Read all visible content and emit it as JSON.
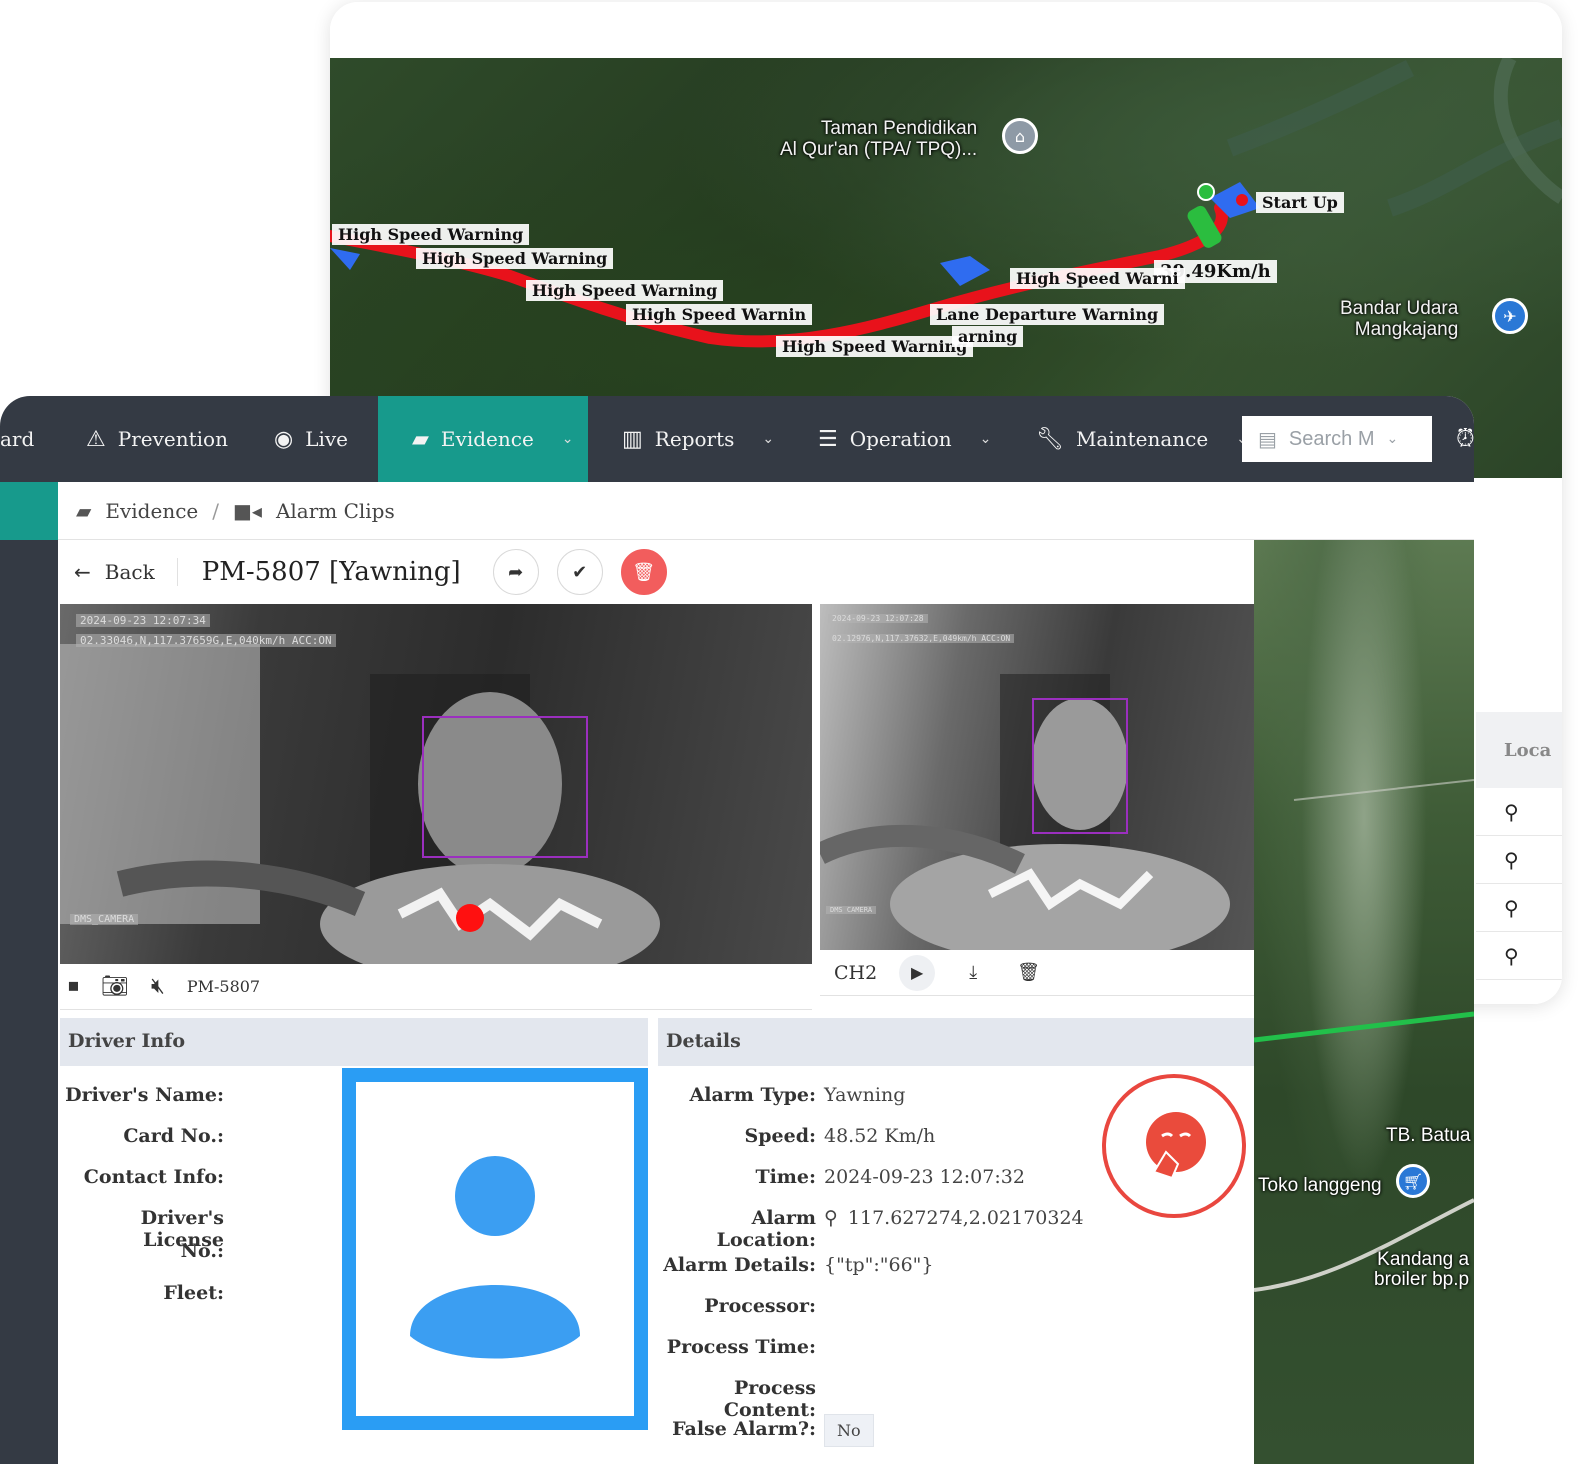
{
  "map": {
    "poi_1": "Taman Pendidikan\nAl Qur'an (TPA/ TPQ)...",
    "airport": "Bandar Udara\nMangkajang",
    "start_label": "Start Up",
    "speed_label": "39.49Km/h",
    "warnings": [
      "High Speed Warning",
      "High Speed Warning",
      "High Speed Warning",
      "High Speed Warnin",
      "High Speed Warning",
      "Lane Departure Warning",
      "High Speed Warni",
      "arning"
    ],
    "side_panel_header": "Loca"
  },
  "nav": {
    "items": [
      {
        "label": "ard"
      },
      {
        "label": "Prevention",
        "icon": "warning-icon"
      },
      {
        "label": "Live",
        "icon": "live-icon"
      },
      {
        "label": "Evidence",
        "icon": "folder-icon"
      },
      {
        "label": "Reports",
        "icon": "bar-chart-icon"
      },
      {
        "label": "Operation",
        "icon": "sliders-icon"
      },
      {
        "label": "Maintenance",
        "icon": "wrench-icon"
      }
    ],
    "search_placeholder": "Search M"
  },
  "breadcrumb": {
    "evidence": "Evidence",
    "separator": "/",
    "alarm_clips": "Alarm Clips"
  },
  "titlebar": {
    "back": "Back",
    "title": "PM-5807 [Yawning]"
  },
  "video_main": {
    "timestamp": "2024-09-23 12:07:34",
    "gps": "02.33046,N,117.37659G,E,040km/h ACC:ON",
    "camera": "DMS_CAMERA",
    "plate": "PM-5807"
  },
  "video_side": {
    "timestamp": "2024-09-23 12:07:28",
    "gps": "02.12976,N,117.37632,E,049km/h ACC:ON",
    "camera": "DMS CAMERA",
    "channel": "CH2"
  },
  "driver_info": {
    "header": "Driver Info",
    "name_label": "Driver's Name:",
    "card_label": "Card No.:",
    "contact_label": "Contact Info:",
    "license_label_1": "Driver's License",
    "license_label_2": "No.:",
    "fleet_label": "Fleet:"
  },
  "details": {
    "header": "Details",
    "alarm_type_label": "Alarm Type:",
    "alarm_type": "Yawning",
    "speed_label": "Speed:",
    "speed": "48.52 Km/h",
    "time_label": "Time:",
    "time": "2024-09-23 12:07:32",
    "location_label": "Alarm Location:",
    "location": "117.627274,2.02170324",
    "alarm_details_label": "Alarm Details:",
    "alarm_details": "{\"tp\":\"66\"}",
    "processor_label": "Processor:",
    "process_time_label": "Process Time:",
    "process_content_label": "Process Content:",
    "false_alarm_label": "False Alarm?:",
    "false_alarm": "No"
  },
  "satellite": {
    "label_1": "TB. Batua",
    "label_2": "Toko langgeng",
    "label_3": "Kandang a\nbroiler bp.p"
  },
  "colors": {
    "nav_bg": "#343a44",
    "accent": "#179a8c",
    "danger": "#f25d5d",
    "avatar_blue": "#2a9df4",
    "track_red": "#e8121b"
  }
}
